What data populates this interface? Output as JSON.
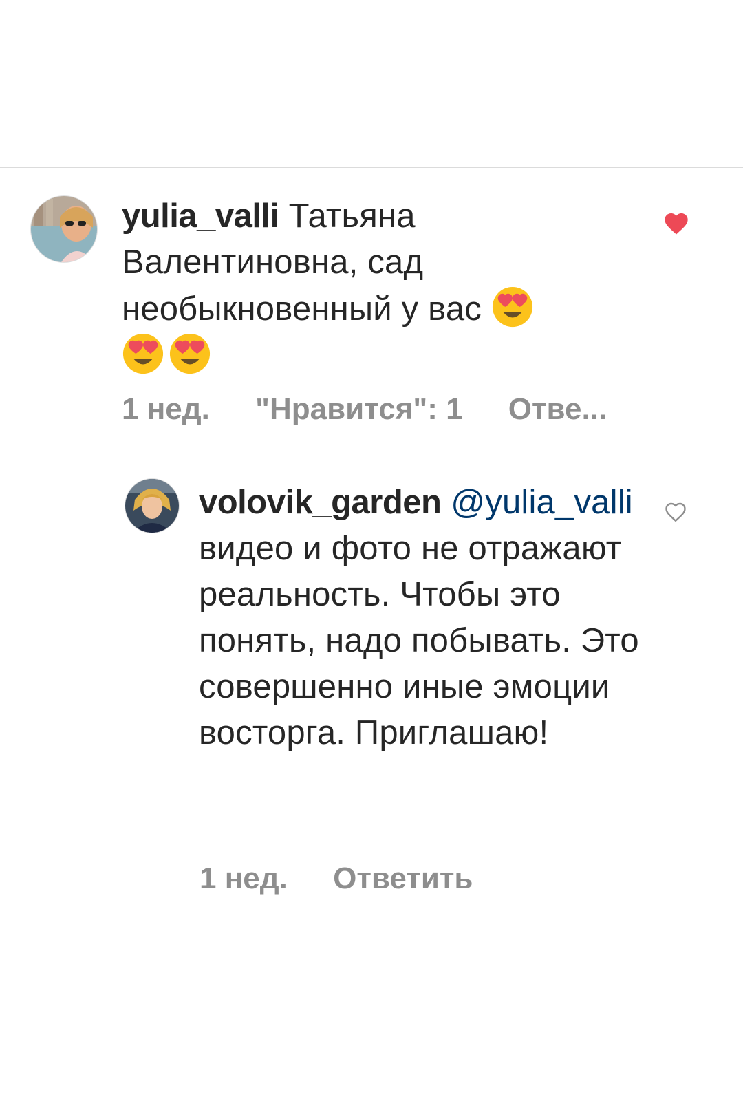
{
  "comments": [
    {
      "username": "yulia_valli",
      "text": "Татьяна Валентиновна, сад необыкновенный у вас",
      "emojis": [
        "smiling-face-with-heart-eyes",
        "smiling-face-with-heart-eyes",
        "smiling-face-with-heart-eyes"
      ],
      "time": "1 нед.",
      "likes_label": "\"Нравится\": 1",
      "reply_label": "Отве...",
      "liked": true
    },
    {
      "username": "volovik_garden",
      "mention": "@yulia_valli",
      "text": "видео и фото не отражают реальность. Чтобы это понять, надо побывать. Это совершенно иные эмоции восторга. Приглашаю!",
      "time": "1 нед.",
      "reply_label": "Ответить",
      "liked": false
    }
  ],
  "colors": {
    "text": "#262626",
    "secondary": "#8e8e8e",
    "mention": "#00376b",
    "like_red": "#ed4956",
    "divider": "#dbdbdb"
  }
}
